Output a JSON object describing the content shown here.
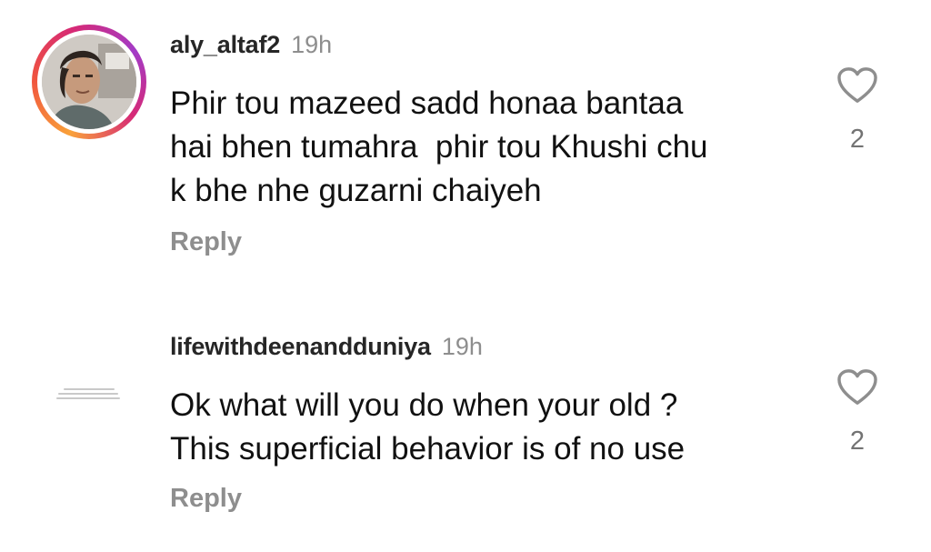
{
  "comments": [
    {
      "username": "aly_altaf2",
      "time": "19h",
      "text": "Phir tou mazeed sadd honaa bantaa\nhai bhen tumahra  phir tou Khushi chu\nk bhe nhe guzarni chaiyeh",
      "reply_label": "Reply",
      "likes": "2",
      "avatar": "profile-photo-with-story-ring",
      "heart_icon": "heart-outline-icon"
    },
    {
      "username": "lifewithdeenandduniya",
      "time": "19h",
      "text": "Ok what will you do when your old ?\nThis superficial behavior is of no use",
      "reply_label": "Reply",
      "likes": "2",
      "avatar": "text-image-avatar",
      "heart_icon": "heart-outline-icon"
    }
  ],
  "colors": {
    "username": "#262626",
    "secondary_text": "#8e8e8e",
    "story_ring_start": "#f9a13a",
    "story_ring_end": "#d62976"
  }
}
